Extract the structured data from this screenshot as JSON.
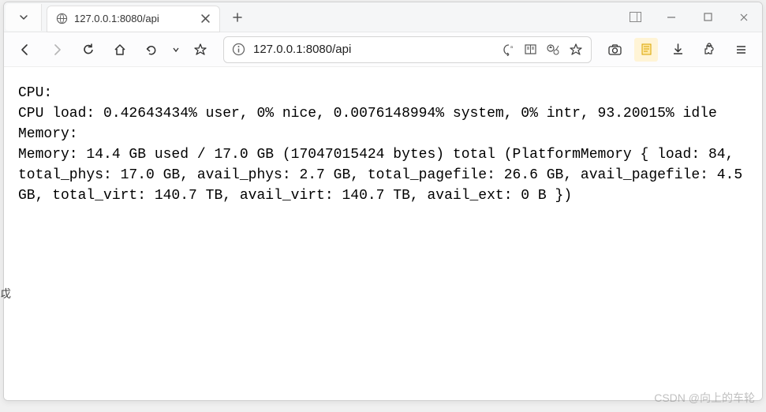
{
  "tab": {
    "title": "127.0.0.1:8080/api"
  },
  "url": "127.0.0.1:8080/api",
  "content": {
    "cpu_header": "CPU:",
    "cpu_line": "CPU load: 0.42643434% user, 0% nice, 0.0076148994% system, 0% intr, 93.20015% idle",
    "mem_header": "Memory:",
    "mem_line": "Memory: 14.4 GB used / 17.0 GB (17047015424 bytes) total (PlatformMemory { load: 84, total_phys: 17.0 GB, avail_phys: 2.7 GB, total_pagefile: 26.6 GB, avail_pagefile: 4.5 GB, total_virt: 140.7 TB, avail_virt: 140.7 TB, avail_ext: 0 B })"
  },
  "watermark": "CSDN @向上的车轮",
  "outside_fragment_char": "戉"
}
